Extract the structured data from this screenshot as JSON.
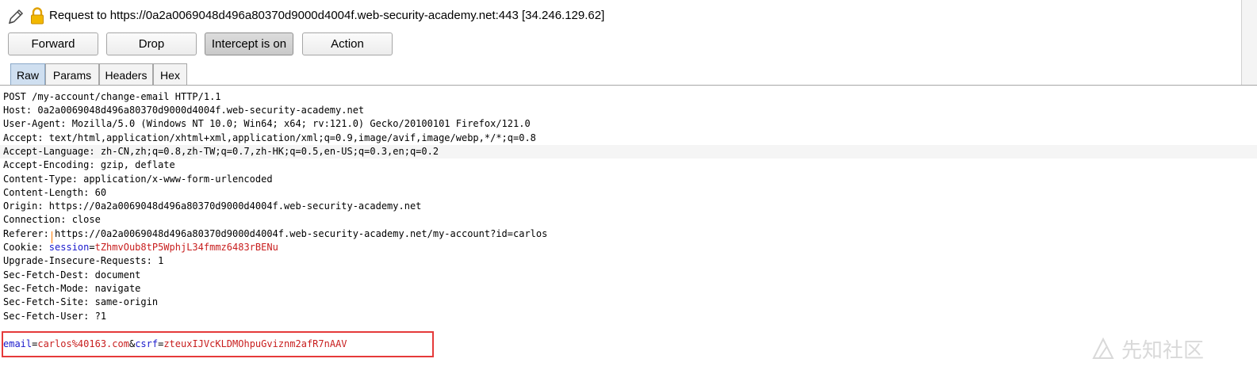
{
  "title": {
    "text": "Request to https://0a2a0069048d496a80370d9000d4004f.web-security-academy.net:443  [34.246.129.62]"
  },
  "toolbar": {
    "forward_label": "Forward",
    "drop_label": "Drop",
    "intercept_label": "Intercept is on",
    "action_label": "Action"
  },
  "tabs": {
    "raw": "Raw",
    "params": "Params",
    "headers": "Headers",
    "hex": "Hex",
    "selected": "Raw"
  },
  "request": {
    "request_line": "POST /my-account/change-email HTTP/1.1",
    "host": "Host: 0a2a0069048d496a80370d9000d4004f.web-security-academy.net",
    "user_agent": "User-Agent: Mozilla/5.0 (Windows NT 10.0; Win64; x64; rv:121.0) Gecko/20100101 Firefox/121.0",
    "accept": "Accept: text/html,application/xhtml+xml,application/xml;q=0.9,image/avif,image/webp,*/*;q=0.8",
    "accept_language_a": "Accept-La",
    "accept_language_b": "nguage: zh-CN,zh;q=0.8,zh-TW;q=0.7,zh-HK;q=0.5,en-US;q=0.3,en;q=0.2",
    "accept_encoding": "Accept-Encoding: gzip, deflate",
    "content_type": "Content-Type: application/x-www-form-urlencoded",
    "content_length": "Content-Length: 60",
    "origin": "Origin: https://0a2a0069048d496a80370d9000d4004f.web-security-academy.net",
    "connection": "Connection: close",
    "referer": "Referer: https://0a2a0069048d496a80370d9000d4004f.web-security-academy.net/my-account?id=carlos",
    "cookie_prefix": "Cookie: ",
    "cookie_name": "session",
    "cookie_eq": "=",
    "cookie_value": "tZhmvOub8tP5WphjL34fmmz6483rBENu",
    "upgrade": "Upgrade-Insecure-Requests: 1",
    "sec_dest": "Sec-Fetch-Dest: document",
    "sec_mode": "Sec-Fetch-Mode: navigate",
    "sec_site": "Sec-Fetch-Site: same-origin",
    "sec_user": "Sec-Fetch-User: ?1",
    "body": {
      "email_key": "email",
      "eq1": "=",
      "email_value": "carlos%40163.com",
      "amp": "&",
      "csrf_key": "csrf",
      "eq2": "=",
      "csrf_value": "zteuxIJVcKLDMOhpuGviznm2afR7nAAV"
    }
  },
  "colors": {
    "highlight_box": "#e53a3a",
    "param_key": "#1a1acc",
    "param_value": "#c81e1e",
    "tab_selected": "#cfdff0"
  },
  "icons": {
    "edit": "pencil-icon",
    "secure": "lock-icon"
  },
  "watermark": {
    "text": "先知社区"
  }
}
